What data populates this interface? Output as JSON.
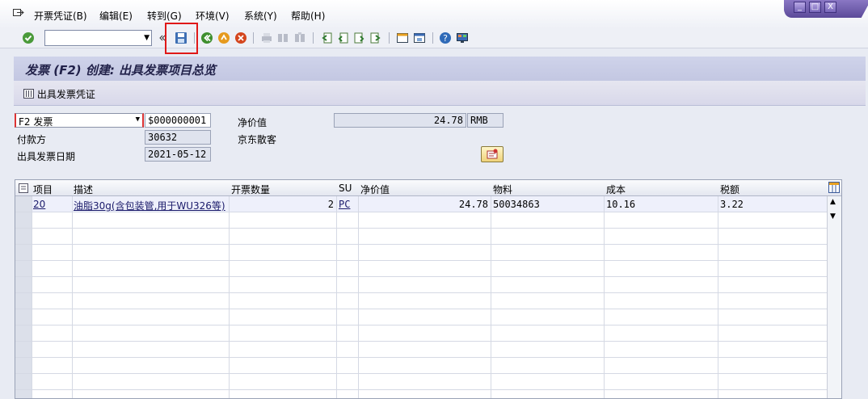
{
  "menu": {
    "items": [
      "开票凭证(B)",
      "编辑(E)",
      "转到(G)",
      "环境(V)",
      "系统(Y)",
      "帮助(H)"
    ]
  },
  "window_controls": {
    "minimize": "_",
    "maximize": "□",
    "close": "X"
  },
  "toolbar": {
    "command_field": {
      "value": "",
      "placeholder": ""
    },
    "icons": [
      "enter-icon",
      "save-icon",
      "back-icon",
      "exit-icon",
      "cancel-icon",
      "print-icon",
      "find-icon",
      "find-next-icon",
      "first-page-icon",
      "previous-page-icon",
      "next-page-icon",
      "last-page-icon",
      "create-session-icon",
      "shortcut-icon",
      "help-icon",
      "layout-icon"
    ]
  },
  "title": "发票 (F2) 创建: 出具发票项目总览",
  "app_toolbar": {
    "invoice_documents_label": "出具发票凭证"
  },
  "header": {
    "billing_type": "F2 发票",
    "document_number": "$000000001",
    "net_value_label": "净价值",
    "net_value": "24.78",
    "currency": "RMB",
    "payer_label": "付款方",
    "payer": "30632",
    "payer_name": "京东散客",
    "billing_date_label": "出具发票日期",
    "billing_date": "2021-05-12"
  },
  "table": {
    "columns": [
      "项目",
      "描述",
      "开票数量",
      "SU",
      "净价值",
      "物料",
      "成本",
      "税额"
    ],
    "rows": [
      {
        "item": "20",
        "description": "油脂30g(含包装管,用于WU326等)",
        "quantity": "2",
        "su": "PC",
        "net_value": "24.78",
        "material": "50034863",
        "cost": "10.16",
        "tax": "3.22"
      }
    ]
  }
}
